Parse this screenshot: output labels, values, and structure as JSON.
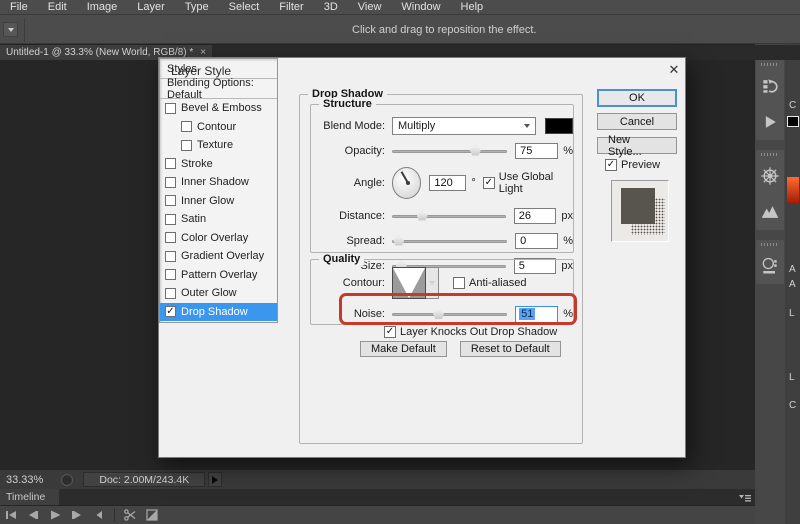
{
  "menu_bar": {
    "items": [
      "File",
      "Edit",
      "Image",
      "Layer",
      "Type",
      "Select",
      "Filter",
      "3D",
      "View",
      "Window",
      "Help"
    ]
  },
  "options_bar": {
    "hint": "Click and drag to reposition the effect."
  },
  "document_tab": {
    "title": "Untitled-1 @ 33.3% (New World, RGB/8) *",
    "close": "×"
  },
  "dialog": {
    "title": "Layer Style",
    "close": "✕",
    "styles_list": {
      "header": "Styles",
      "blending": "Blending Options: Default",
      "items": [
        {
          "label": "Bevel & Emboss",
          "checked": false,
          "indent": false,
          "selected": false
        },
        {
          "label": "Contour",
          "checked": false,
          "indent": true,
          "selected": false
        },
        {
          "label": "Texture",
          "checked": false,
          "indent": true,
          "selected": false
        },
        {
          "label": "Stroke",
          "checked": false,
          "indent": false,
          "selected": false
        },
        {
          "label": "Inner Shadow",
          "checked": false,
          "indent": false,
          "selected": false
        },
        {
          "label": "Inner Glow",
          "checked": false,
          "indent": false,
          "selected": false
        },
        {
          "label": "Satin",
          "checked": false,
          "indent": false,
          "selected": false
        },
        {
          "label": "Color Overlay",
          "checked": false,
          "indent": false,
          "selected": false
        },
        {
          "label": "Gradient Overlay",
          "checked": false,
          "indent": false,
          "selected": false
        },
        {
          "label": "Pattern Overlay",
          "checked": false,
          "indent": false,
          "selected": false
        },
        {
          "label": "Outer Glow",
          "checked": false,
          "indent": false,
          "selected": false
        },
        {
          "label": "Drop Shadow",
          "checked": true,
          "indent": false,
          "selected": true
        }
      ]
    },
    "panel": {
      "legend": "Drop Shadow",
      "structure": {
        "legend": "Structure",
        "blend_mode_label": "Blend Mode:",
        "blend_mode_value": "Multiply",
        "opacity_label": "Opacity:",
        "opacity_value": "75",
        "opacity_unit": "%",
        "angle_label": "Angle:",
        "angle_value": "120",
        "angle_unit": "°",
        "use_global_light": "Use Global Light",
        "distance_label": "Distance:",
        "distance_value": "26",
        "distance_unit": "px",
        "spread_label": "Spread:",
        "spread_value": "0",
        "spread_unit": "%",
        "size_label": "Size:",
        "size_value": "5",
        "size_unit": "px"
      },
      "quality": {
        "legend": "Quality",
        "contour_label": "Contour:",
        "anti_aliased": "Anti-aliased",
        "noise_label": "Noise:",
        "noise_value": "51",
        "noise_unit": "%"
      },
      "knockout": "Layer Knocks Out Drop Shadow",
      "make_default": "Make Default",
      "reset_default": "Reset to Default"
    },
    "buttons": {
      "ok": "OK",
      "cancel": "Cancel",
      "new_style": "New Style...",
      "preview": "Preview"
    }
  },
  "right_dock": {
    "collapse": "«",
    "icons": [
      "history",
      "actions",
      "navigator",
      "histogram",
      "color-themes"
    ]
  },
  "right_edge_panel": {
    "fragments": [
      "C",
      "A",
      "A",
      "L",
      "L",
      "C"
    ]
  },
  "status_bar": {
    "zoom": "33.33%",
    "doc": "Doc: 2.00M/243.4K"
  },
  "timeline": {
    "tab": "Timeline",
    "controls": [
      "first-frame",
      "previous-frame",
      "play",
      "next-frame",
      "audio",
      "split",
      "transition"
    ]
  },
  "colors": {
    "selection_blue": "#3b97ee",
    "annotation_red": "#c63a2c",
    "shadow_swatch": "#000000"
  }
}
